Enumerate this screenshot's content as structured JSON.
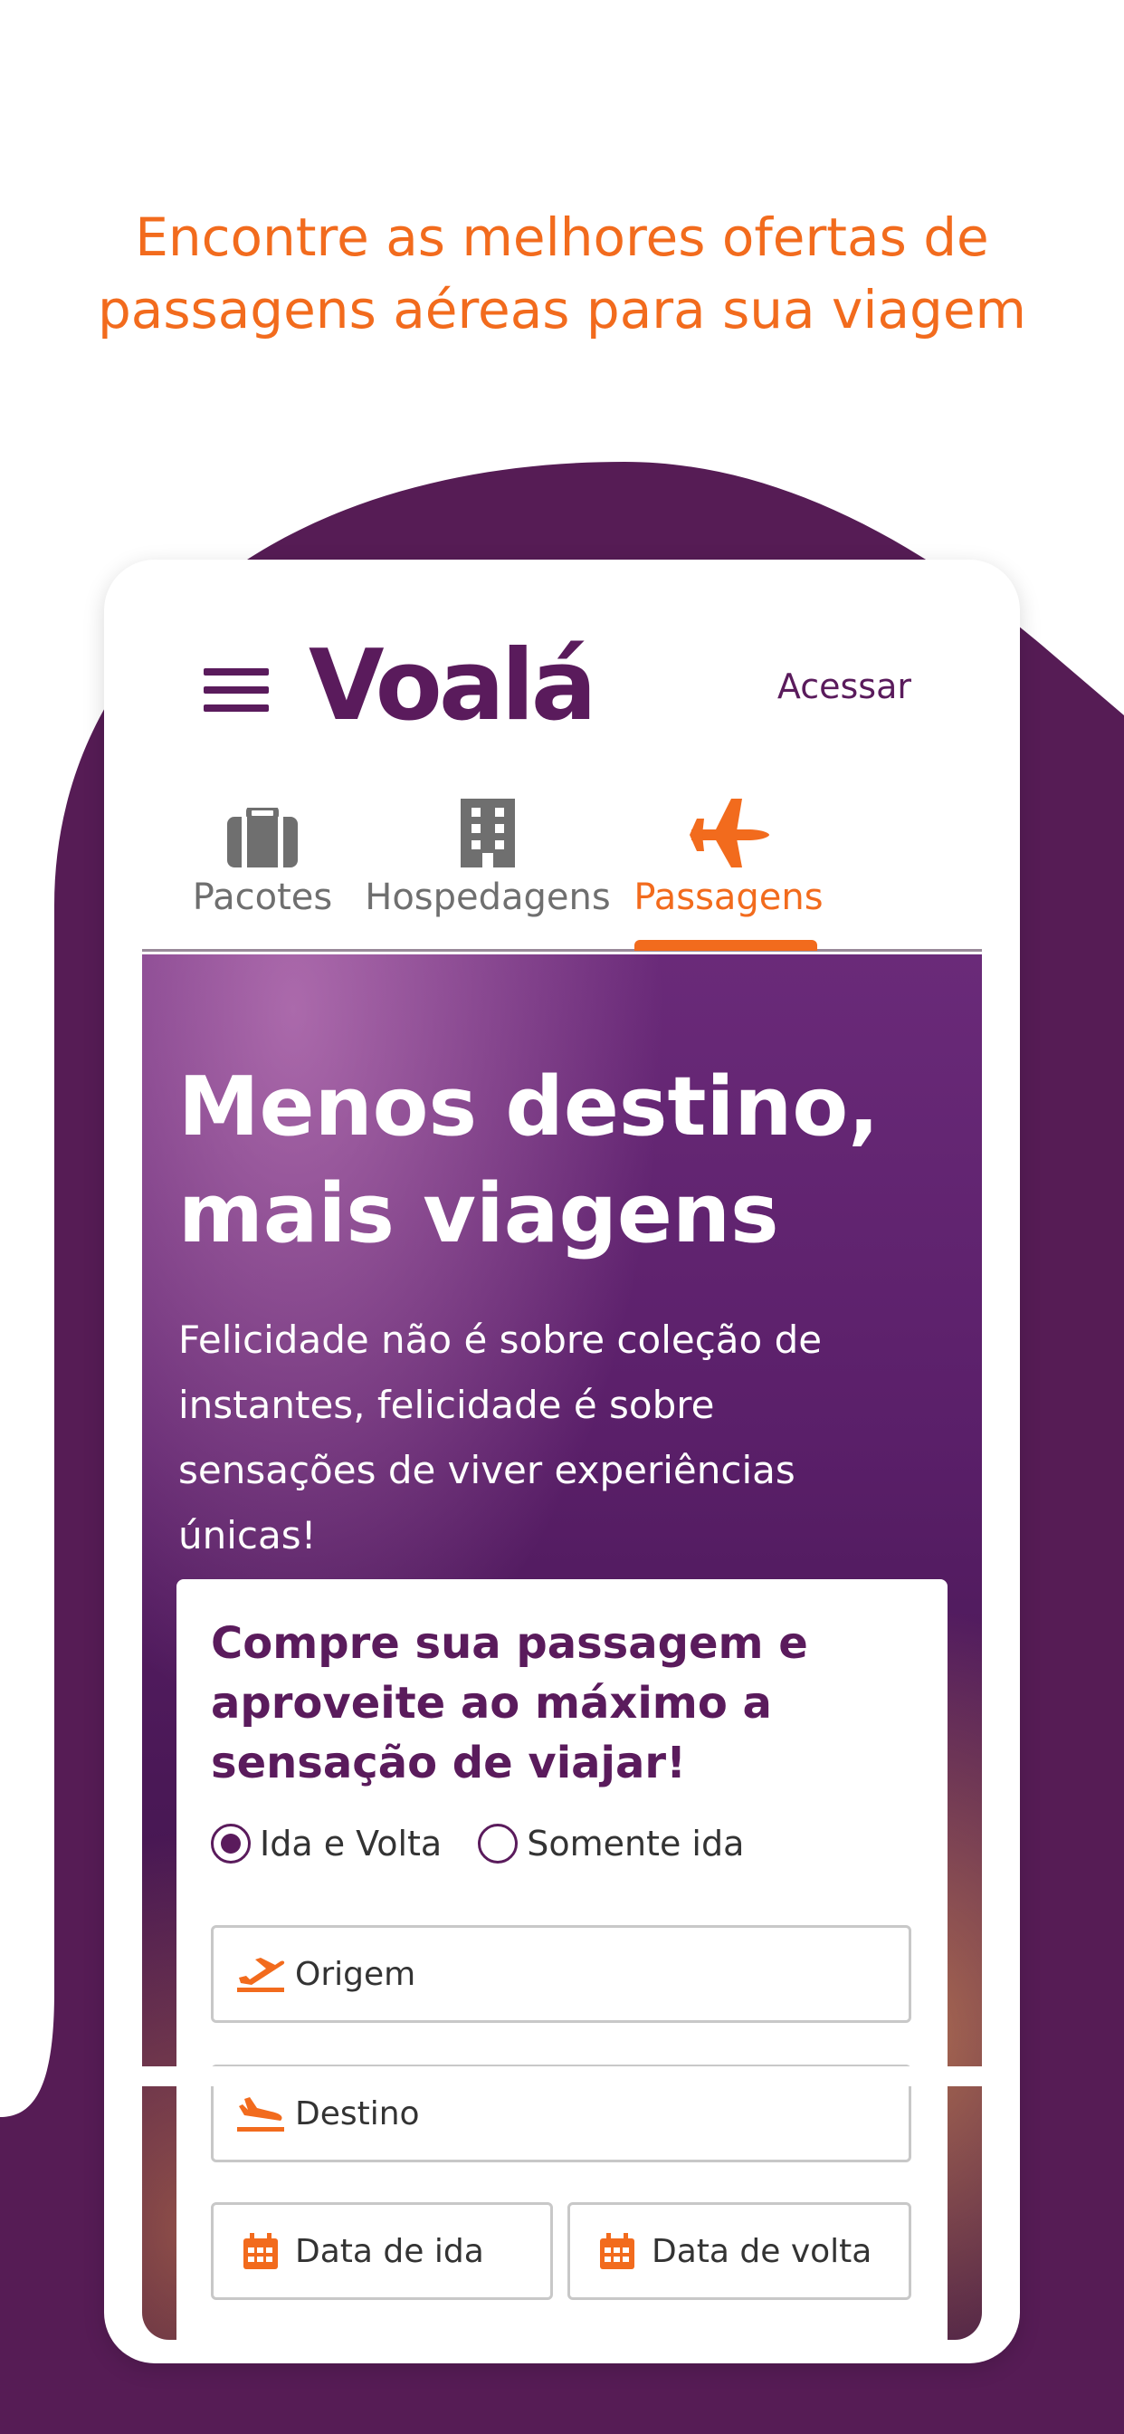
{
  "headline": {
    "line1": "Encontre as melhores ofertas de",
    "line2": "passagens aéreas para sua viagem"
  },
  "header": {
    "menu_icon": "hamburger-menu-icon",
    "logo_text": "Voalá",
    "login_label": "Acessar"
  },
  "tabs": [
    {
      "label": "Pacotes",
      "icon": "briefcase-icon",
      "active": false
    },
    {
      "label": "Hospedagens",
      "icon": "building-icon",
      "active": false
    },
    {
      "label": "Passagens",
      "icon": "airplane-icon",
      "active": true
    }
  ],
  "hero": {
    "title_line1": "Menos destino,",
    "title_line2": "mais viagens",
    "subtitle": "Felicidade não é sobre coleção de instantes, felicidade é sobre sensações de viver experiências únicas!"
  },
  "form": {
    "title": "Compre sua passagem e aproveite ao máximo a sensação de viajar!",
    "trip_type": {
      "options": [
        "Ida e Volta",
        "Somente ida"
      ],
      "selected": "Ida e Volta"
    },
    "origin_placeholder": "Origem",
    "destination_placeholder": "Destino",
    "departure_placeholder": "Data de ida",
    "return_placeholder": "Data de volta"
  },
  "colors": {
    "brand_purple": "#5a1b5c",
    "accent_orange": "#f26b1d",
    "background_blob": "#561c55"
  }
}
